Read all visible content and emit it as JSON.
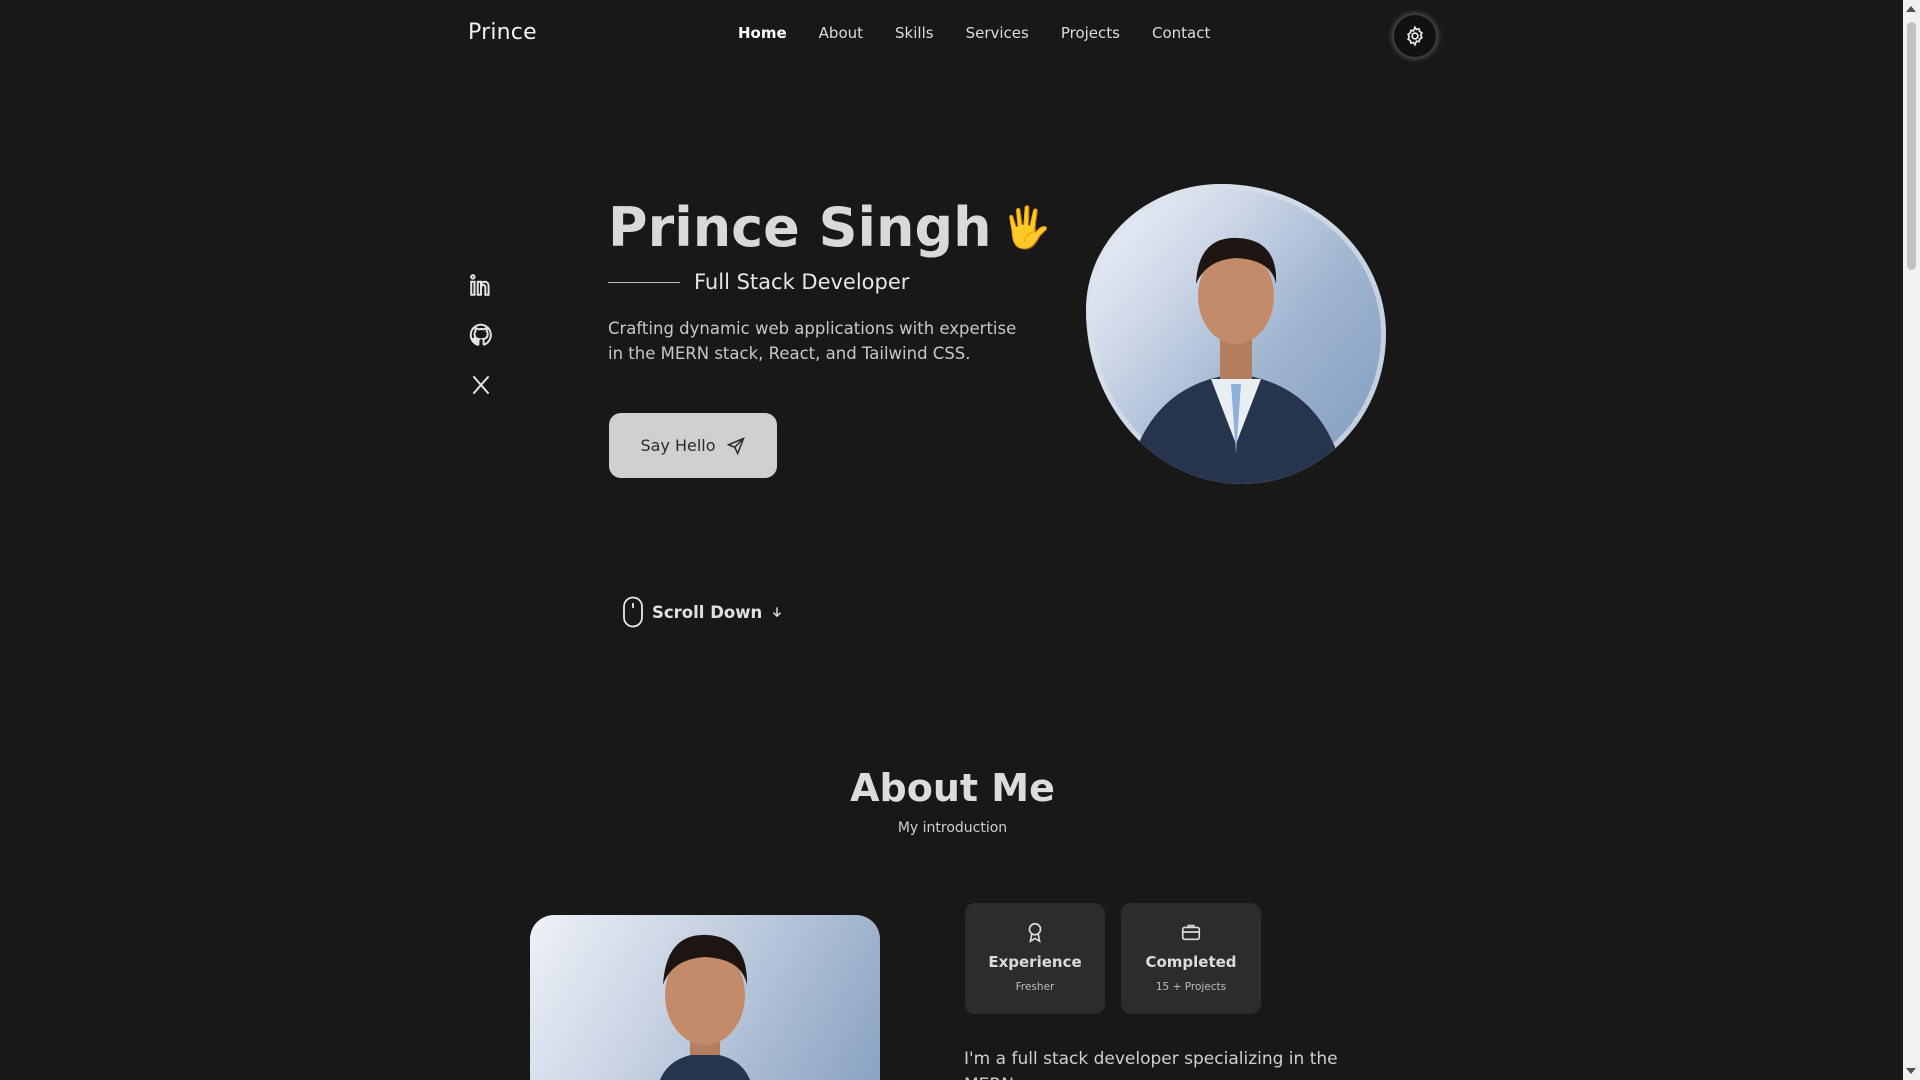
{
  "header": {
    "logo": "Prince",
    "nav": [
      "Home",
      "About",
      "Skills",
      "Services",
      "Projects",
      "Contact"
    ],
    "active_nav": "Home",
    "theme_icon": "gear-icon"
  },
  "social": [
    {
      "name": "linkedin-icon"
    },
    {
      "name": "github-icon"
    },
    {
      "name": "x-twitter-icon"
    }
  ],
  "hero": {
    "name": "Prince Singh",
    "emoji": "🖐",
    "subtitle": "Full Stack Developer",
    "description": "Crafting dynamic web applications with expertise in the MERN stack, React, and Tailwind CSS.",
    "cta_label": "Say Hello",
    "cta_icon": "send-icon",
    "scroll_label": "Scroll Down"
  },
  "about": {
    "title": "About Me",
    "subtitle": "My introduction",
    "cards": [
      {
        "title": "Experience",
        "sub": "Fresher",
        "icon": "award-icon"
      },
      {
        "title": "Completed",
        "sub": "15 + Projects",
        "icon": "briefcase-icon"
      }
    ],
    "text": "I'm a full stack developer specializing in the MERN"
  },
  "colors": {
    "background": "#181818",
    "button": "#d0d0d0",
    "card": "#2c2c2c"
  }
}
